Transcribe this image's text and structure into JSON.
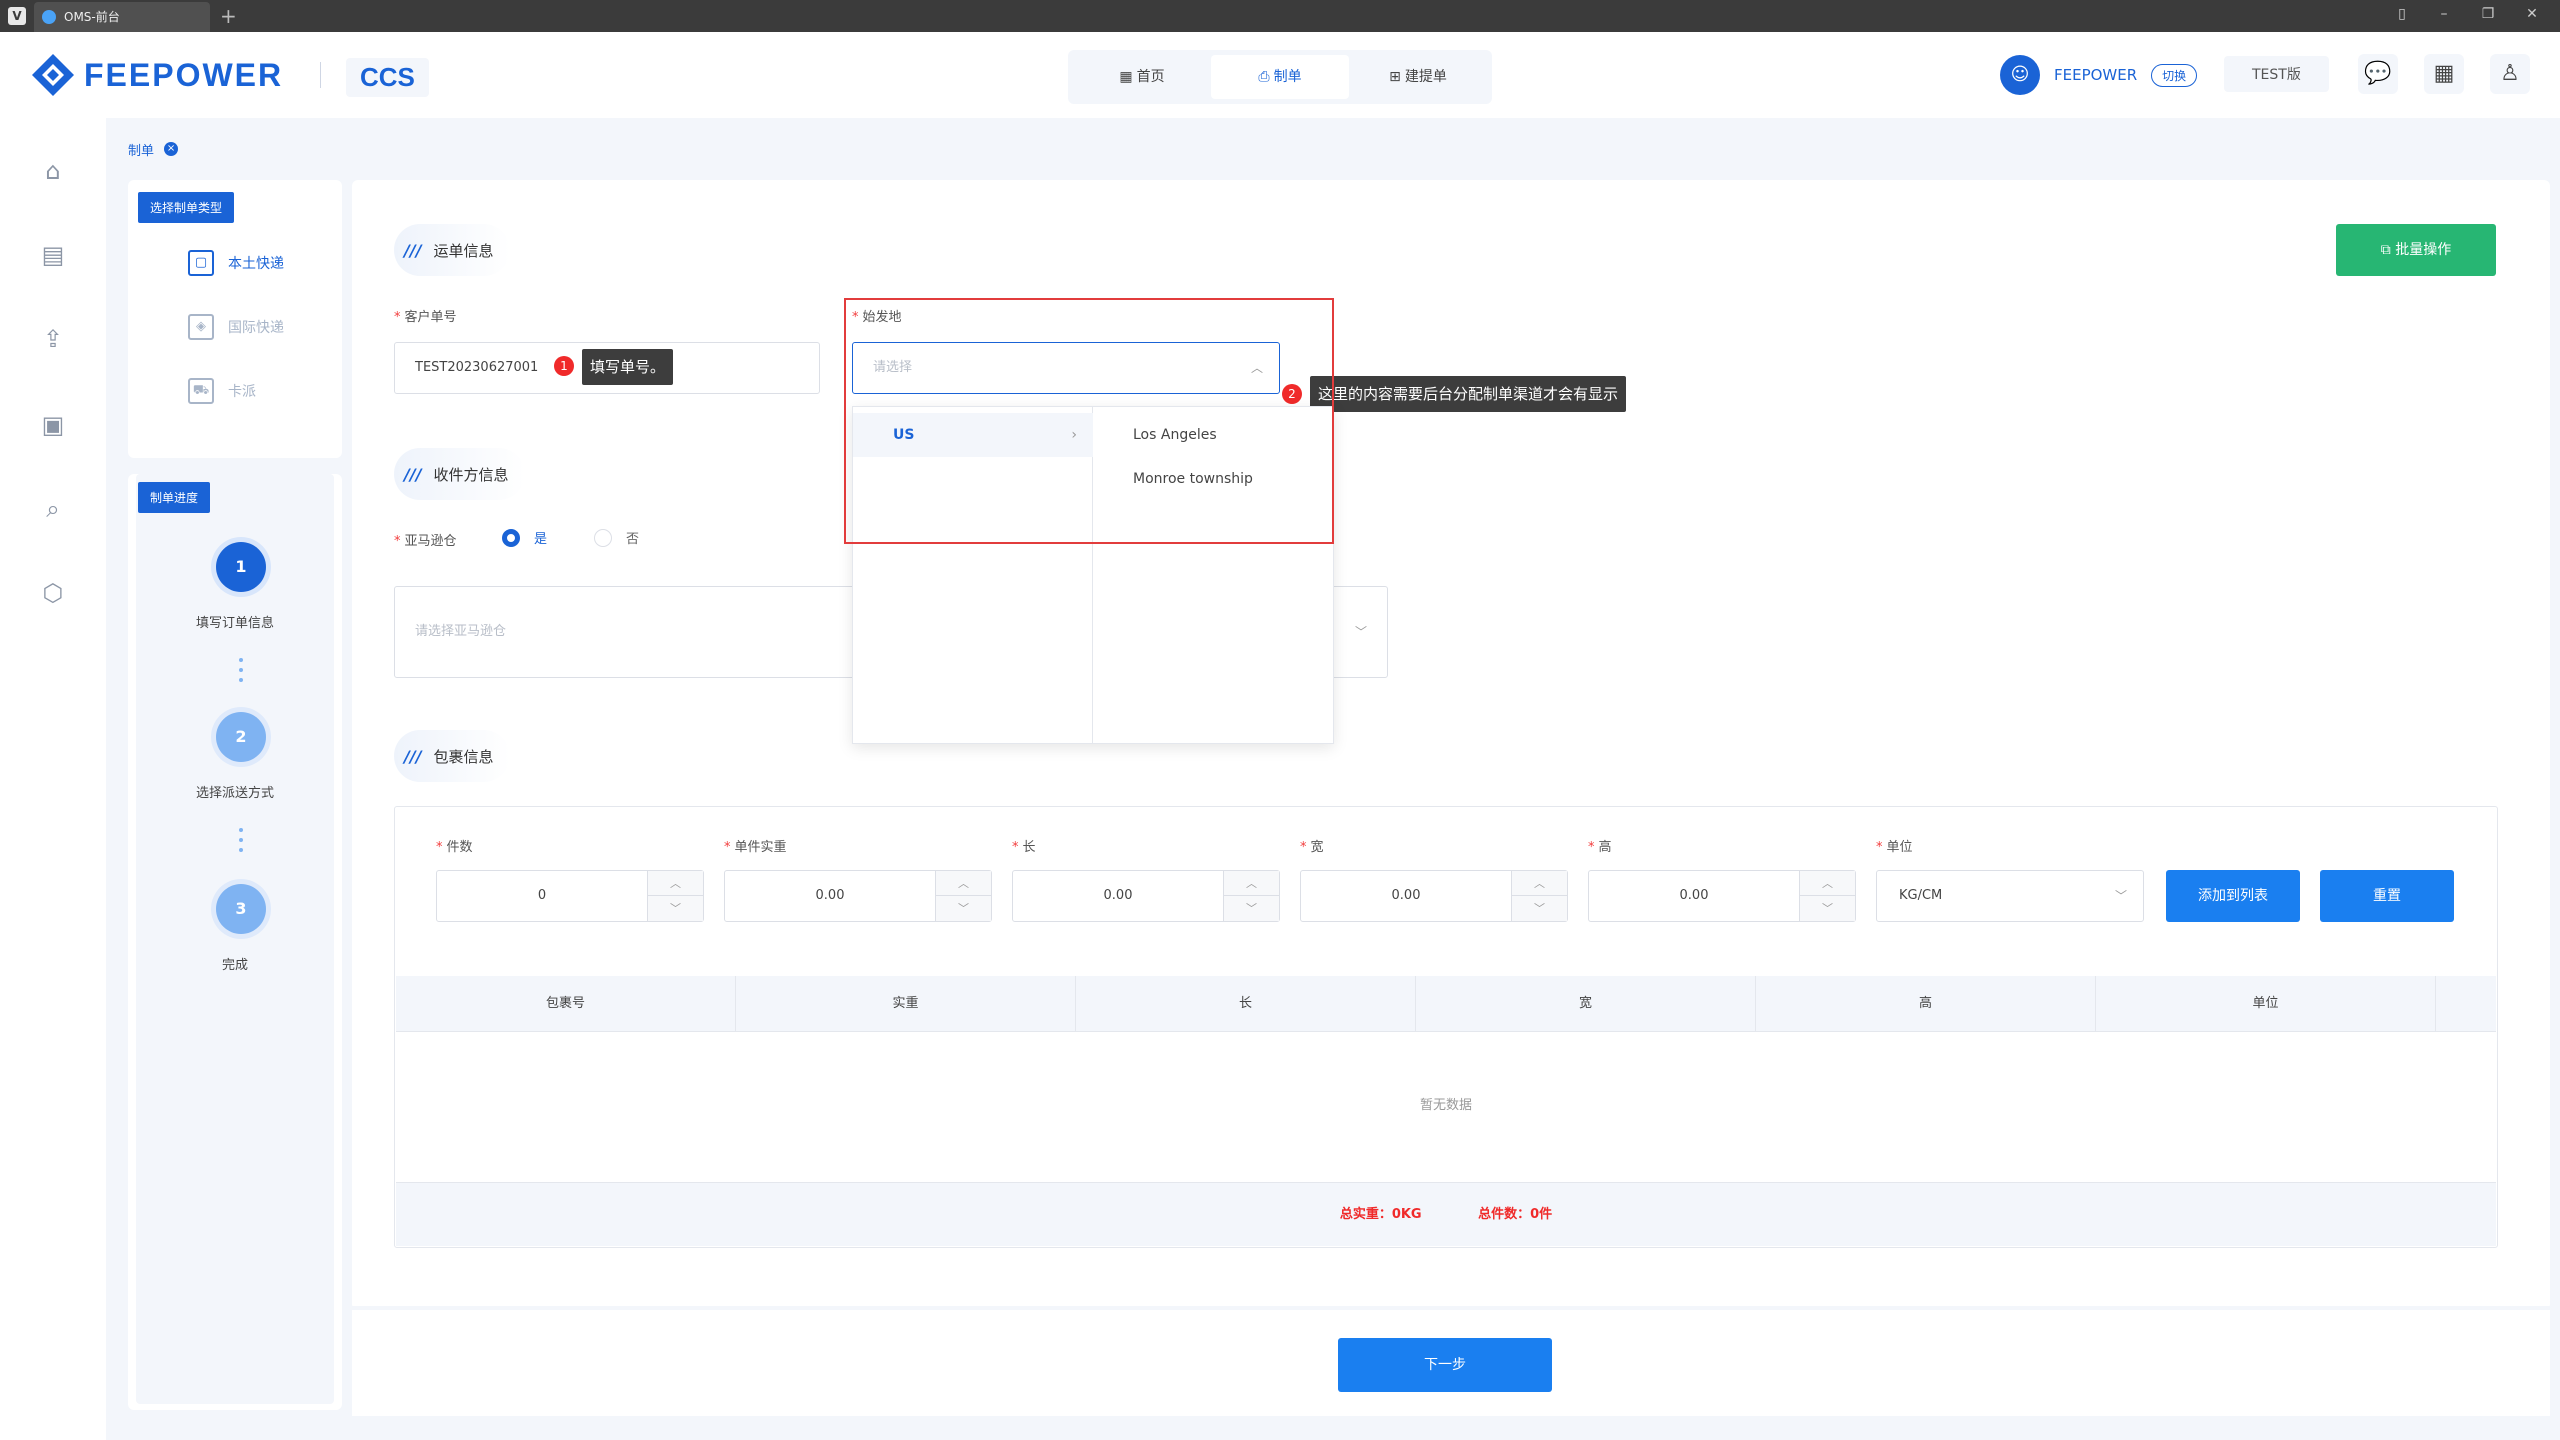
{
  "browser": {
    "tab_title": "OMS-前台",
    "app_icon": "V",
    "new_tab": "+"
  },
  "header": {
    "logo_text": "FEEPOWER",
    "product": "CCS",
    "nav": [
      {
        "label": "首页",
        "icon": "grid-icon"
      },
      {
        "label": "制单",
        "icon": "user-doc-icon"
      },
      {
        "label": "建提单",
        "icon": "doc-plus-icon"
      }
    ],
    "user_name": "FEEPOWER",
    "switch_label": "切换",
    "env_label": "TEST版",
    "icons": [
      "message-icon",
      "calendar-icon",
      "user-icon"
    ]
  },
  "breadcrumb": {
    "label": "制单",
    "close": "×"
  },
  "type_panel": {
    "title": "选择制单类型",
    "items": [
      {
        "label": "本土快递",
        "icon": "box-icon",
        "state": "active"
      },
      {
        "label": "国际快递",
        "icon": "cube-icon",
        "state": "dim"
      },
      {
        "label": "卡派",
        "icon": "truck-icon",
        "state": "dim"
      }
    ]
  },
  "progress_panel": {
    "title": "制单进度",
    "steps": [
      {
        "num": "1",
        "label": "填写订单信息",
        "state": "on"
      },
      {
        "num": "2",
        "label": "选择派送方式",
        "state": "off"
      },
      {
        "num": "3",
        "label": "完成",
        "state": "off"
      }
    ]
  },
  "waybill": {
    "section_title": "运单信息",
    "customer_no_label": "客户单号",
    "customer_no_value": "TEST20230627001",
    "origin_label": "始发地",
    "origin_placeholder": "请选择",
    "batch_button": "批量操作"
  },
  "annotations": [
    {
      "num": "1",
      "text": "填写单号。"
    },
    {
      "num": "2",
      "text": "这里的内容需要后台分配制单渠道才会有显示"
    }
  ],
  "origin_dropdown": {
    "countries": [
      {
        "label": "US",
        "selected": true
      }
    ],
    "cities": [
      "Los Angeles",
      "Monroe township"
    ]
  },
  "recipient": {
    "section_title": "收件方信息",
    "amazon_label": "亚马逊仓",
    "yes": "是",
    "no": "否",
    "amazon_placeholder": "请选择亚马逊仓"
  },
  "package": {
    "section_title": "包裹信息",
    "fields": [
      {
        "label": "件数",
        "value": "0"
      },
      {
        "label": "单件实重",
        "value": "0.00"
      },
      {
        "label": "长",
        "value": "0.00"
      },
      {
        "label": "宽",
        "value": "0.00"
      },
      {
        "label": "高",
        "value": "0.00"
      }
    ],
    "unit_label": "单位",
    "unit_value": "KG/CM",
    "add_button": "添加到列表",
    "reset_button": "重置",
    "table_headers": [
      "包裹号",
      "实重",
      "长",
      "宽",
      "高",
      "单位"
    ],
    "empty_text": "暂无数据",
    "total_weight": "总实重：0KG",
    "total_count": "总件数：0件"
  },
  "next_button": "下一步",
  "colors": {
    "primary": "#1a63d6",
    "button_blue": "#1a7ff0",
    "green": "#27b673",
    "annotation_red": "#f02a2a",
    "page_bg": "#f3f6fb"
  }
}
